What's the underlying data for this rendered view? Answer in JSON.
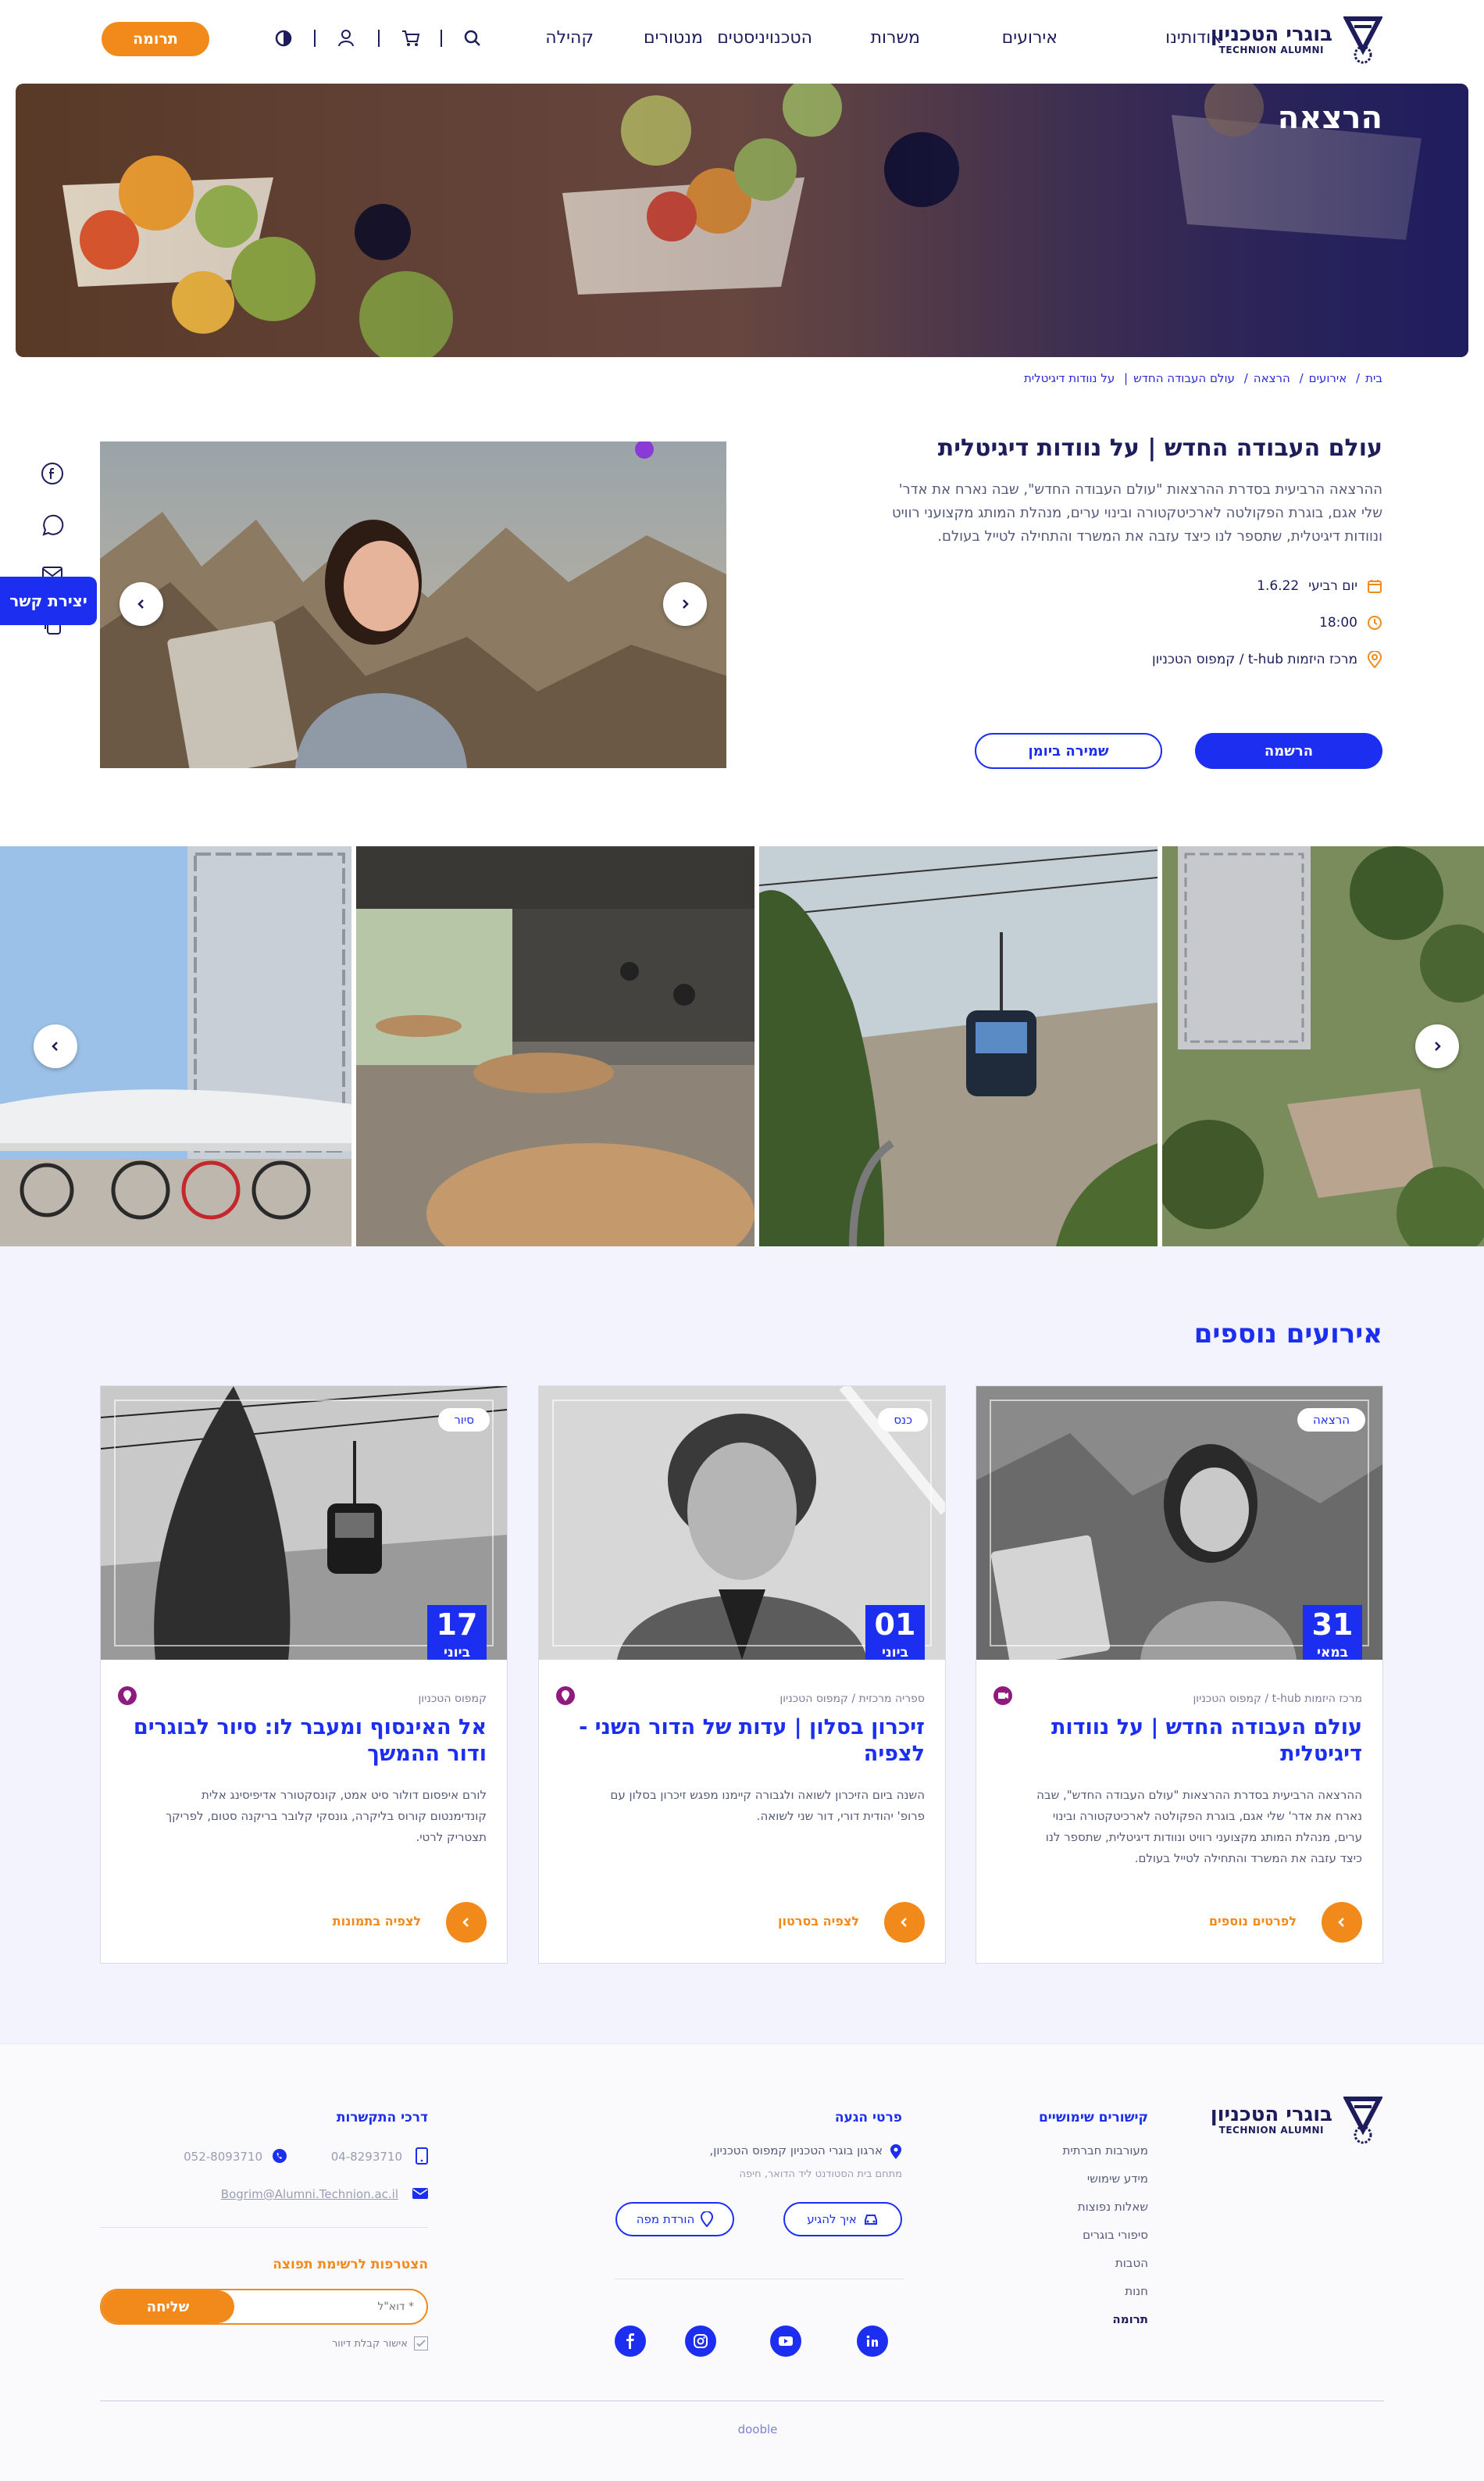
{
  "header": {
    "logo": {
      "he": "בוגרי הטכניון",
      "en": "TECHNION ALUMNI"
    },
    "nav": [
      "אודותינו",
      "אירועים",
      "משרות",
      "הטכנויניסטים",
      "מנטורים",
      "קהילה"
    ],
    "donate": "תרומה",
    "icons": [
      "search-icon",
      "cart-icon",
      "user-icon",
      "contrast-icon"
    ]
  },
  "hero": {
    "title": "הרצאה"
  },
  "breadcrumb": [
    "בית",
    "אירועים",
    "הרצאה",
    "עולם העבודה החדש",
    "על נוודות דיגיטלית"
  ],
  "event": {
    "title": "עולם העבודה החדש | על נוודות דיגיטלית",
    "description": "ההרצאה הרביעית בסדרת ההרצאות \"עולם העבודה החדש\", שבה נארח את אדר' שלי אגם, בוגרת הפקולטה לארכיטקטורה ובינוי ערים, מנהלת המותג מקצועני רוויט ונוודות דיגיטלית, שתספר לנו כיצד עזבה את המשרד והתחילה לטייל בעולם.",
    "date": "1.6.22",
    "weekday": "יום רביעי",
    "time": "18:00",
    "location": "מרכז היזמות t-hub  /  קמפוס הטכניון",
    "register": "הרשמה",
    "save_calendar": "שמירה ביומן"
  },
  "contact_tab": "יצירת קשר",
  "share_icons": [
    "facebook-icon",
    "whatsapp-icon",
    "email-icon",
    "copy-icon"
  ],
  "more": {
    "title": "אירועים נוספים",
    "cards": [
      {
        "tag": "הרצאה",
        "day": "31",
        "month": "במאי",
        "location": "מרכז היזמות t-hub  /  קמפוס הטכניון",
        "title": "עולם העבודה החדש | על נוודות דיגיטלית",
        "desc": "ההרצאה הרביעית בסדרת ההרצאות \"עולם העבודה החדש\", שבה נארח את אדר' שלי אגם, בוגרת הפקולטה לארכיטקטורה ובינוי ערים, מנהלת המותג מקצועני רוויט ונוודות דיגיטלית, שתספר לנו כיצד עזבה את המשרד והתחילה לטייל בעולם.",
        "link": "לפרטים נוספים"
      },
      {
        "tag": "כנס",
        "day": "01",
        "month": "ביוני",
        "location": "ספריה מרכזית  /  קמפוס הטכניון",
        "title": "זיכרון בסלון | עדות של הדור השני - לצפיה",
        "desc": "השנה ביום הזיכרון לשואה ולגבורה קיימנו מפגש זיכרון בסלון עם פרופ' יהודית דורי, דור שני לשואה.",
        "link": "לצפיה בסרטון"
      },
      {
        "tag": "סיור",
        "day": "17",
        "month": "ביוני",
        "location": "קמפוס הטכניון",
        "title": "אל האינסוף ומעבר לו: סיור לבוגרים ודור ההמשך",
        "desc": "לורם איפסום דולור סיט אמט, קונסקטורר אדיפיסינג אלית קונדימנטום קורוס בליקרה, גונסקי קלובר בריקנה סטום, לפריקך תצטריק לרטי.",
        "link": "לצפיה בתמונות"
      }
    ]
  },
  "footer": {
    "logo": {
      "he": "בוגרי הטכניון",
      "en": "TECHNION ALUMNI"
    },
    "links_title": "קישורים שימושיים",
    "links": [
      "מעורבות חברתית",
      "מידע שימושי",
      "שאלות נפוצות",
      "סיפורי בוגרים",
      "הטבות",
      "חנות",
      "תרומה"
    ],
    "arrival_title": "פרטי הגעה",
    "address_line1": "ארגון בוגרי הטכניון קמפוס הטכניון,",
    "address_line2": "מתחם בית הסטודנט ליד הדואר, חיפה",
    "how_to_get": "איך להגיע",
    "download_map": "הורדת מפה",
    "contact_title": "דרכי התקשרות",
    "phone": "04-8293710",
    "whatsapp": "052-8093710",
    "email": "Bogrim@Alumni.Technion.ac.il",
    "newsletter_title": "הצטרפות לרשימת תפוצה",
    "email_placeholder": "* דוא\"ל",
    "send": "שליחה",
    "consent": "אישור קבלת דיוור",
    "credit": "dooble",
    "social_icons": [
      "linkedin-icon",
      "youtube-icon",
      "instagram-icon",
      "facebook-icon"
    ]
  }
}
